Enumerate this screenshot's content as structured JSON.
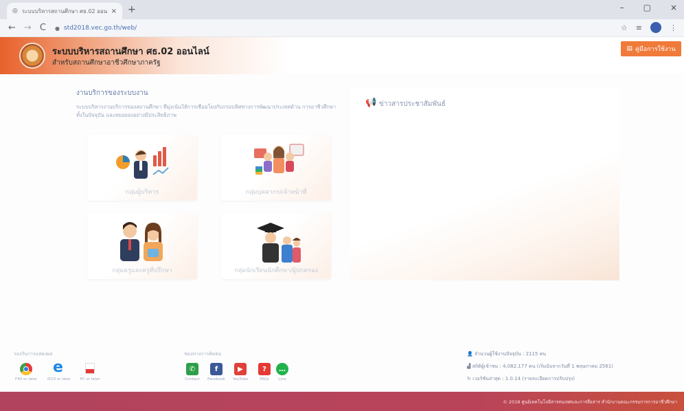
{
  "browser": {
    "tab_title": "ระบบบริหารสถานศึกษา ศธ.02 ออนไล...",
    "tab_close": "×",
    "new_tab": "+",
    "win_min": "–",
    "win_max": "▢",
    "win_close": "×",
    "back": "←",
    "forward": "→",
    "reload": "C",
    "url": "std2018.vec.go.th/web/",
    "star": "☆",
    "menu": "⋮"
  },
  "header": {
    "title": "ระบบบริหารสถานศึกษา ศธ.02 ออนไลน์",
    "subtitle": "สำหรับสถานศึกษาอาชีวศึกษาภาครัฐ",
    "manual_button": "คู่มือการใช้งาน"
  },
  "services": {
    "title": "งานบริการของระบบงาน",
    "description": "ระบบบริหารงานบริการของสถานศึกษา ที่มุ่งเน้นให้การเชื่อมโยงกับกรอบทิศทางการพัฒนาประเทศด้าน การอาชีวศึกษาทั้งในปัจจุบัน และทยอยลงอย่างมีประสิทธิภาพ",
    "cards": [
      {
        "label": "กลุ่มผู้บริหาร"
      },
      {
        "label": "กลุ่มบุคลากร/เจ้าหน้าที่"
      },
      {
        "label": "กลุ่มครูและครูที่ปรึกษา"
      },
      {
        "label": "กลุ่มนักเรียนนักศึกษา/ผู้ปกครอง"
      }
    ]
  },
  "news": {
    "title": "ข่าวสารประชาสัมพันธ์"
  },
  "footer": {
    "browsers_title": "รองรับการแสดงผล",
    "browsers": [
      {
        "caption": "F40 or later"
      },
      {
        "caption": "IE10 or later"
      },
      {
        "caption": "PC or later"
      }
    ],
    "contact_title": "ช่องทางการติดต่อ",
    "contacts": [
      {
        "caption": "Contact",
        "color": "#2f9e4a"
      },
      {
        "caption": "Facebook",
        "color": "#3b5998"
      },
      {
        "caption": "YouTube",
        "color": "#e0403a"
      },
      {
        "caption": "FAQs",
        "color": "#e53935"
      },
      {
        "caption": "Line",
        "color": "#21b24b"
      }
    ],
    "stats": {
      "online": "จำนวนผู้ใช้งานปัจจุบัน : 2115 คน",
      "visitors": "สถิติผู้เข้าชม : 4,082,177 คน (เริ่มนับจากวันที่ 1 พฤษภาคม 2561)",
      "update": "เวอร์ชันล่าสุด : 1.0.14 (รายละเอียดการปรับปรุง)"
    },
    "copyright": "© 2018 ศูนย์เทคโนโลยีสารสนเทศและการสื่อสาร สำนักงานคณะกรรมการการอาชีวศึกษา"
  },
  "colors": {
    "accent": "#f07a3a",
    "bottom_bar": "#b1435e"
  }
}
